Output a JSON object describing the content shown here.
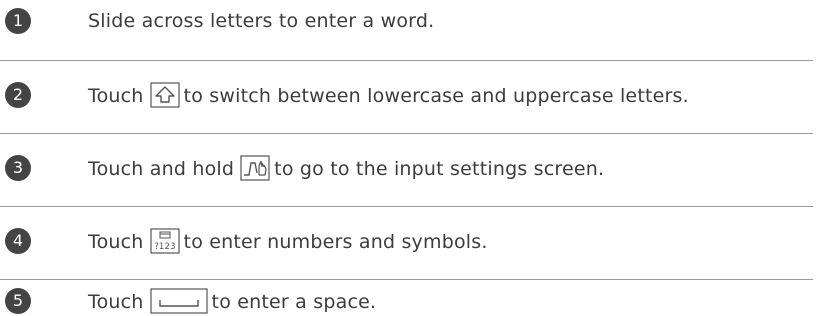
{
  "steps": [
    {
      "number": "1",
      "text": "Slide across letters to enter a word."
    },
    {
      "number": "2",
      "before": "Touch",
      "icon": "shift-key-icon",
      "after": "to switch between lowercase and uppercase letters."
    },
    {
      "number": "3",
      "before": "Touch and hold",
      "icon": "swipe-gesture-key-icon",
      "after": "to go to the input settings screen."
    },
    {
      "number": "4",
      "before": "Touch",
      "icon": "symbols-key-icon",
      "icon_text": "?123",
      "after": "to enter numbers and symbols."
    },
    {
      "number": "5",
      "before": "Touch",
      "icon": "space-key-icon",
      "after": "to enter a space."
    }
  ],
  "colors": {
    "badge": "#444444",
    "text": "#3c3c3c",
    "divider": "#9a9a9a"
  }
}
